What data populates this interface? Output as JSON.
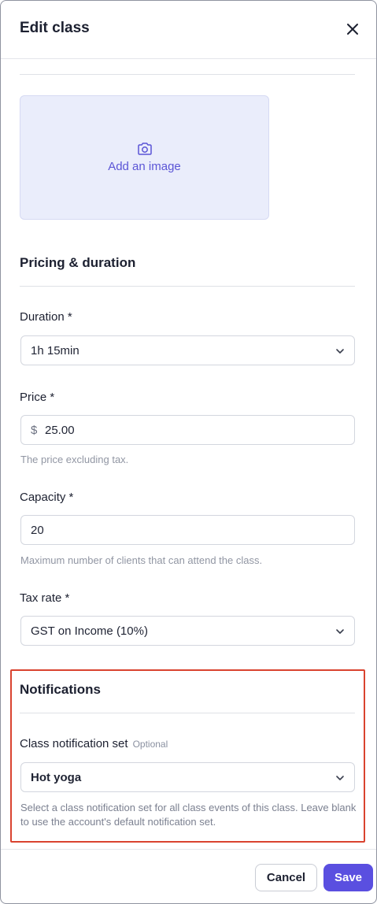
{
  "header": {
    "title": "Edit class",
    "close_icon": "close-icon"
  },
  "image_upload": {
    "icon": "camera-icon",
    "label": "Add an image",
    "accent": "#5b55d6"
  },
  "pricing": {
    "title": "Pricing & duration",
    "duration": {
      "label": "Duration *",
      "value": "1h 15min"
    },
    "price": {
      "label": "Price *",
      "currency_symbol": "$",
      "value": "25.00",
      "hint": "The price excluding tax."
    },
    "capacity": {
      "label": "Capacity *",
      "value": "20",
      "hint": "Maximum number of clients that can attend the class."
    },
    "tax_rate": {
      "label": "Tax rate *",
      "value": "GST on Income (10%)"
    }
  },
  "notifications": {
    "title": "Notifications",
    "notification_set": {
      "label": "Class notification set",
      "optional_tag": "Optional",
      "value": "Hot yoga",
      "hint": "Select a class notification set for all class events of this class. Leave blank to use the account's default notification set."
    },
    "highlight_color": "#d9432f"
  },
  "footer": {
    "cancel_label": "Cancel",
    "save_label": "Save",
    "primary_color": "#5a4fe0"
  }
}
